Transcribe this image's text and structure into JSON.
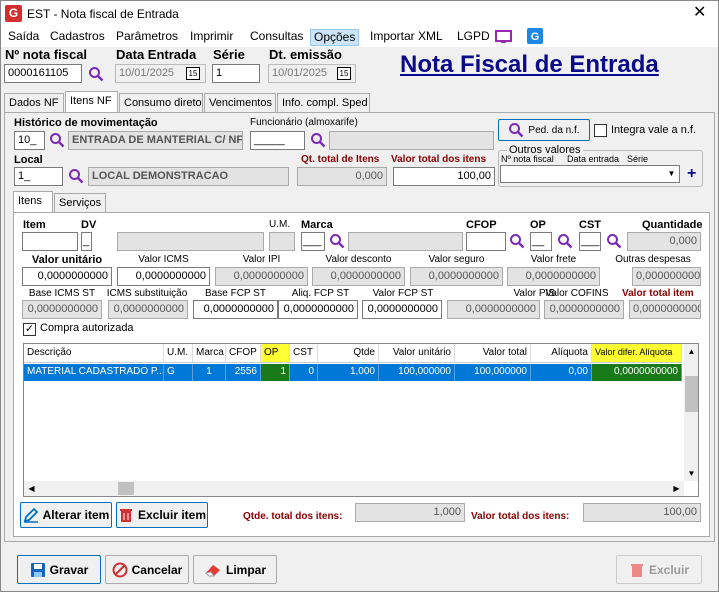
{
  "window": {
    "title": "EST - Nota fiscal de Entrada",
    "app_icon_letter": "G"
  },
  "menu": [
    "Saída",
    "Cadastros",
    "Parâmetros",
    "Imprimir",
    "Consultas",
    "Opções",
    "Importar XML",
    "LGPD"
  ],
  "header": {
    "nota_label": "Nº nota fiscal",
    "nota_value": "0000161105",
    "data_entrada_label": "Data Entrada",
    "data_entrada_value": "10/01/2025",
    "serie_label": "Série",
    "serie_value": "1",
    "dt_emissao_label": "Dt. emissão",
    "dt_emissao_value": "10/01/2025",
    "calendar_label": "15",
    "big_title": "Nota Fiscal de Entrada"
  },
  "main_tabs": [
    "Dados NF",
    "Itens NF",
    "Consumo direto",
    "Vencimentos",
    "Info. compl. Sped"
  ],
  "top": {
    "historico_label": "Histórico de movimentação",
    "historico_code": "10_",
    "historico_desc": "ENTRADA DE MANTERIAL C/ NF",
    "funcionario_label": "Funcionário (almoxarife)",
    "funcionario_code": "_____",
    "funcionario_desc": "",
    "ped_button": "Ped. da n.f.",
    "integra_label": "Integra vale a n.f.",
    "local_label": "Local",
    "local_code": "1_",
    "local_desc": "LOCAL DEMONSTRACAO",
    "qt_total_label": "Qt. total de Itens",
    "qt_total_value": "0,000",
    "valor_total_label": "Valor total dos itens",
    "valor_total_value": "100,00",
    "outros_label": "Outros valores",
    "outros_cols": [
      "Nº nota fiscal",
      "Data entrada",
      "Série"
    ],
    "plus": "+"
  },
  "sub_tabs": [
    "Itens",
    "Serviços"
  ],
  "item": {
    "item_label": "Item",
    "dv_label": "DV",
    "dv_value": "_",
    "um_label": "U.M.",
    "marca_label": "Marca",
    "marca_value": "___",
    "cfop_label": "CFOP",
    "op_label": "OP",
    "op_value": "__",
    "cst_label": "CST",
    "cst_value": "___",
    "quantidade_label": "Quantidade",
    "quantidade_value": "0,000"
  },
  "row1": [
    {
      "label": "Valor unitário",
      "value": "0,0000000000",
      "bold": true
    },
    {
      "label": "Valor ICMS",
      "value": "0,0000000000"
    },
    {
      "label": "Valor IPI",
      "value": "0,0000000000"
    },
    {
      "label": "Valor desconto",
      "value": "0,0000000000"
    },
    {
      "label": "Valor seguro",
      "value": "0,0000000000"
    },
    {
      "label": "Valor frete",
      "value": "0,0000000000"
    },
    {
      "label": "Outras despesas",
      "value": "0,0000000000"
    }
  ],
  "row2": [
    {
      "label": "Base ICMS ST",
      "value": "0,0000000000"
    },
    {
      "label": "ICMS substituição",
      "value": "0,0000000000"
    },
    {
      "label": "Base FCP ST",
      "value": "0,0000000000"
    },
    {
      "label": "Aliq. FCP ST",
      "value": "0,0000000000"
    },
    {
      "label": "Valor FCP ST",
      "value": "0,0000000000"
    },
    {
      "label": "Valor PIS",
      "value": "0,0000000000"
    },
    {
      "label": "Valor COFINS",
      "value": "0,0000000000"
    },
    {
      "label": "Valor total item",
      "value": "0,0000000000"
    }
  ],
  "compra_label": "Compra autorizada",
  "grid": {
    "columns": [
      "Descrição",
      "U.M.",
      "Marca",
      "CFOP",
      "OP",
      "CST",
      "Qtde",
      "Valor unitário",
      "Valor total",
      "Alíquota",
      "Valor difer. Alíquota"
    ],
    "rows": [
      [
        "MATERIAL CADASTRADO P...",
        "G",
        "1",
        "2556",
        "1",
        "0",
        "1,000",
        "100,000000",
        "100,000000",
        "0,00",
        "0,0000000000"
      ]
    ]
  },
  "footer": {
    "alterar": "Alterar item",
    "excluir_item": "Excluir item",
    "qtde_total_label": "Qtde. total dos itens:",
    "qtde_total_value": "1,000",
    "valor_total_label": "Valor total dos itens:",
    "valor_total_value": "100,00"
  },
  "bottom": {
    "gravar": "Gravar",
    "cancelar": "Cancelar",
    "limpar": "Limpar",
    "excluir": "Excluir"
  },
  "colors": {
    "accent": "#0078d7",
    "title": "#0a0a8a",
    "red_label": "#8b0000",
    "magnifier": "#7a2bb5",
    "yellow": "#ffff33",
    "green": "#1a7a1a"
  }
}
